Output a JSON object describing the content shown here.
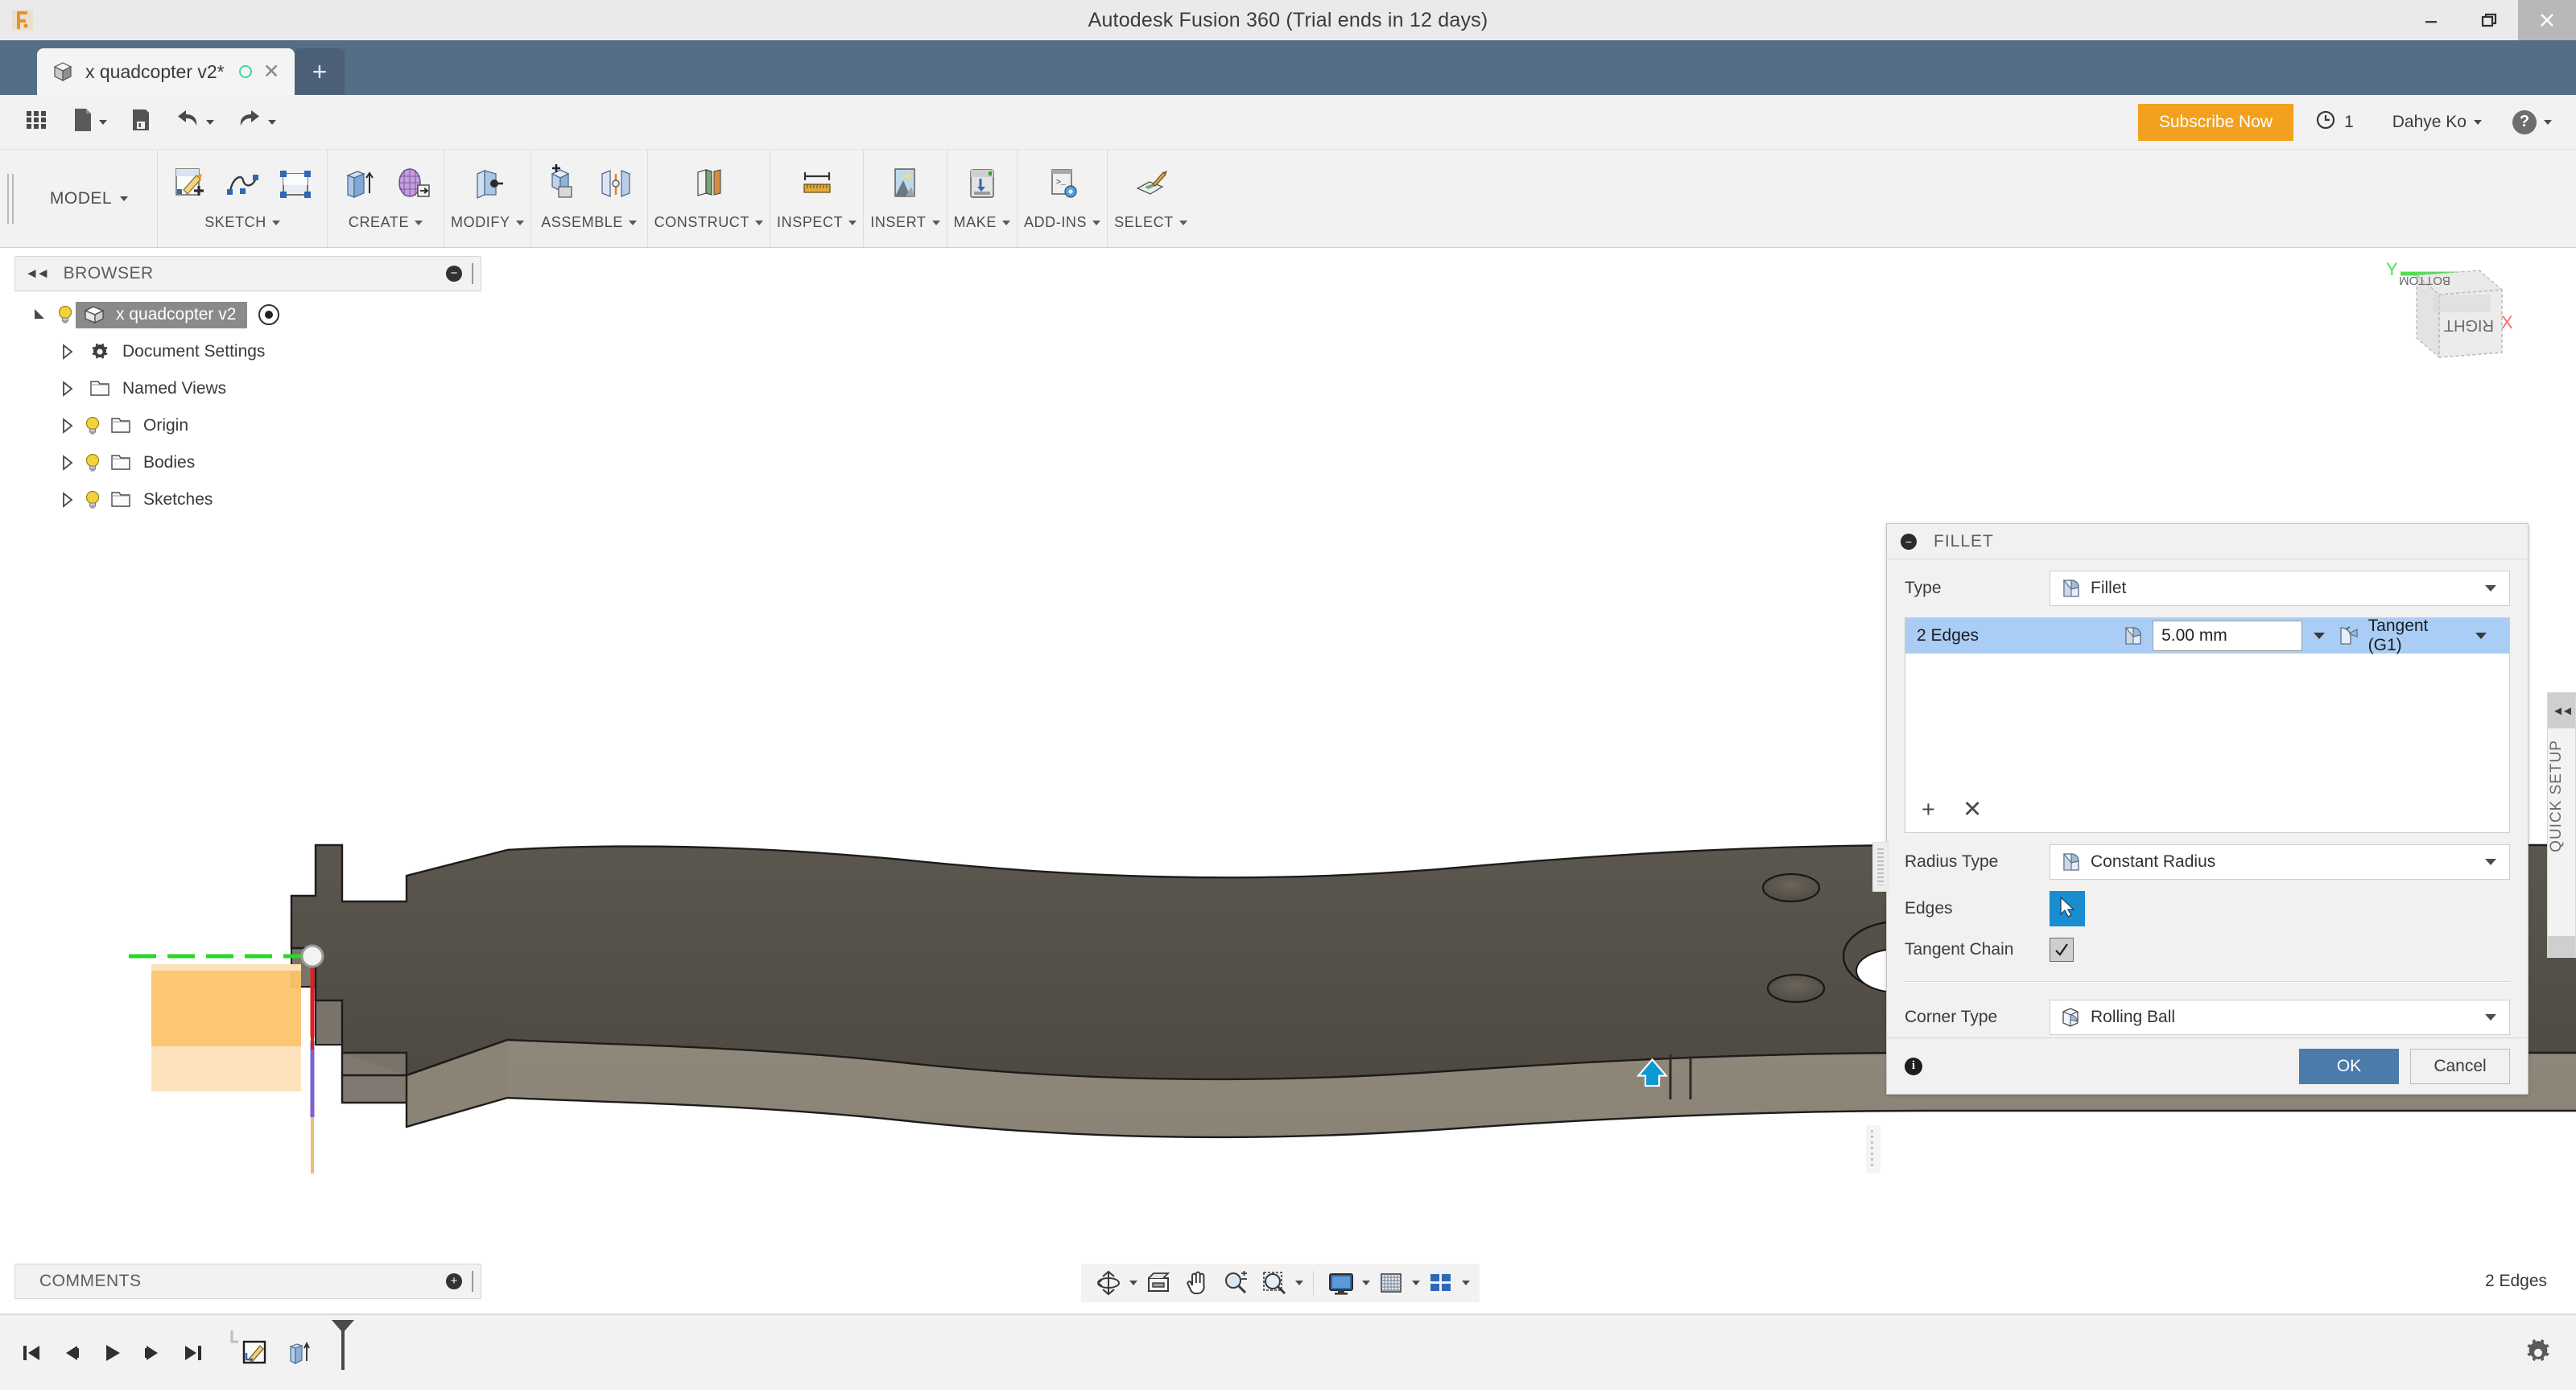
{
  "window": {
    "title": "Autodesk Fusion 360 (Trial ends in 12 days)",
    "app_icon": "fusion-logo-icon",
    "minimize": "–",
    "restore": "❐",
    "close": "✕"
  },
  "tabs": {
    "document": {
      "label": "x quadcopter v2*",
      "icon": "cube-icon",
      "save_state_icon": "unsaved-circle-icon",
      "close": "✕"
    },
    "new_tab": "+"
  },
  "quick_access": {
    "items": [
      {
        "name": "show-data-panel",
        "icon": "grid-icon",
        "caret": false
      },
      {
        "name": "file-menu",
        "icon": "file-icon",
        "caret": true
      },
      {
        "name": "save",
        "icon": "save-icon",
        "caret": false
      },
      {
        "name": "undo",
        "icon": "undo-icon",
        "caret": true
      },
      {
        "name": "redo",
        "icon": "redo-icon",
        "caret": true
      }
    ],
    "subscribe_label": "Subscribe Now",
    "subscribe_color": "#f2a01e",
    "job_count": "1",
    "job_icon": "clock-icon",
    "user_name": "Dahye Ko",
    "help_icon": "question-mark-icon"
  },
  "ribbon": {
    "workspace": "MODEL",
    "groups": [
      {
        "label": "SKETCH",
        "icons": [
          "create-sketch-icon",
          "spline-icon",
          "rectangle-icon"
        ]
      },
      {
        "label": "CREATE",
        "icons": [
          "extrude-icon",
          "form-icon"
        ]
      },
      {
        "label": "MODIFY",
        "icons": [
          "press-pull-icon"
        ]
      },
      {
        "label": "ASSEMBLE",
        "icons": [
          "new-component-icon",
          "joint-icon"
        ]
      },
      {
        "label": "CONSTRUCT",
        "icons": [
          "offset-plane-icon"
        ]
      },
      {
        "label": "INSPECT",
        "icons": [
          "measure-icon"
        ]
      },
      {
        "label": "INSERT",
        "icons": [
          "insert-image-icon"
        ]
      },
      {
        "label": "MAKE",
        "icons": [
          "3d-print-icon"
        ]
      },
      {
        "label": "ADD-INS",
        "icons": [
          "scripts-addins-icon"
        ]
      },
      {
        "label": "SELECT",
        "icons": [
          "select-paint-icon"
        ]
      }
    ]
  },
  "browser": {
    "title": "BROWSER",
    "collapse_icon": "double-chevron-left-icon",
    "minus_icon": "minus-circle-icon",
    "tree": [
      {
        "label": "x quadcopter v2",
        "icon": "component-cube-icon",
        "bulb": true,
        "indent": 0,
        "selected": true,
        "expanded": true,
        "radio": true
      },
      {
        "label": "Document Settings",
        "icon": "gear-icon",
        "bulb": false,
        "indent": 1,
        "selected": false,
        "expanded": false,
        "radio": false
      },
      {
        "label": "Named Views",
        "icon": "folder-icon",
        "bulb": false,
        "indent": 1,
        "selected": false,
        "expanded": false,
        "radio": false
      },
      {
        "label": "Origin",
        "icon": "folder-icon",
        "bulb": true,
        "indent": 1,
        "selected": false,
        "expanded": false,
        "radio": false
      },
      {
        "label": "Bodies",
        "icon": "folder-icon",
        "bulb": true,
        "indent": 1,
        "selected": false,
        "expanded": false,
        "radio": false
      },
      {
        "label": "Sketches",
        "icon": "folder-icon",
        "bulb": true,
        "indent": 1,
        "selected": false,
        "expanded": false,
        "radio": false
      }
    ]
  },
  "viewcube": {
    "face_front": "RIGHT",
    "face_top": "BOTTOM",
    "axis_y": "Y",
    "axis_x": "X",
    "axis_y_color": "#4fe04f",
    "axis_x_color": "#ff6a6a"
  },
  "quick_setup": {
    "label": "QUICK SETUP",
    "collapse_icon": "double-chevron-left-icon"
  },
  "fillet_dialog": {
    "title": "FILLET",
    "minimize_icon": "minus-circle-icon",
    "type_label": "Type",
    "type_value": "Fillet",
    "type_icon": "fillet-icon",
    "selection": {
      "count_label": "2 Edges",
      "edge_icon": "fillet-edge-icon",
      "radius_value": "5.00 mm",
      "continuity_icon": "tangent-icon",
      "continuity_value": "Tangent (G1)"
    },
    "add_icon": "+",
    "remove_icon": "✕",
    "radius_type_label": "Radius Type",
    "radius_type_value": "Constant Radius",
    "radius_type_icon": "constant-radius-icon",
    "edges_label": "Edges",
    "edges_button_icon": "select-cursor-icon",
    "edges_button_color": "#1a8cd0",
    "tangent_chain_label": "Tangent Chain",
    "tangent_chain_checked": true,
    "corner_type_label": "Corner Type",
    "corner_type_value": "Rolling Ball",
    "corner_type_icon": "rolling-ball-icon",
    "info_icon": "info-icon",
    "ok_label": "OK",
    "cancel_label": "Cancel",
    "ok_color": "#4a7bab",
    "highlight_color": "#aacdf5"
  },
  "comments": {
    "title": "COMMENTS",
    "add_icon": "plus-circle-icon"
  },
  "navbar": {
    "items": [
      {
        "name": "orbit",
        "icon": "orbit-icon",
        "caret": true
      },
      {
        "name": "look-at",
        "icon": "look-at-icon",
        "caret": false
      },
      {
        "name": "pan",
        "icon": "pan-hand-icon",
        "caret": false
      },
      {
        "name": "zoom",
        "icon": "zoom-icon",
        "caret": false
      },
      {
        "name": "zoom-window",
        "icon": "zoom-window-icon",
        "caret": true
      },
      {
        "name": "display-settings",
        "icon": "display-icon",
        "caret": true
      },
      {
        "name": "grid-snaps",
        "icon": "grid-snap-icon",
        "caret": true
      },
      {
        "name": "viewports",
        "icon": "viewports-icon",
        "caret": true
      }
    ]
  },
  "status_bar": {
    "selection_text": "2 Edges"
  },
  "timeline": {
    "controls": [
      {
        "name": "go-to-beginning",
        "icon": "skip-start-icon"
      },
      {
        "name": "step-back",
        "icon": "step-back-icon"
      },
      {
        "name": "play",
        "icon": "play-icon"
      },
      {
        "name": "step-forward",
        "icon": "step-forward-icon"
      },
      {
        "name": "go-to-end",
        "icon": "skip-end-icon"
      }
    ],
    "features": [
      {
        "name": "sketch-feature",
        "icon": "sketch-feature-icon"
      },
      {
        "name": "extrude-feature",
        "icon": "extrude-feature-icon"
      }
    ],
    "marker_icon": "timeline-marker-icon",
    "settings_icon": "gear-icon"
  },
  "model": {
    "cursor_icon": "blue-arrow-cursor",
    "body_top_color": "#58544c",
    "body_side_color": "#8d8679",
    "sketch_fill_color": "#fbc46a",
    "sketch_fill_light": "#fde2b8",
    "axis_x_color": "#33dd33",
    "axis_y_color": "#ee2222",
    "axis_z_color": "#f7b559",
    "origin_point": "origin-point-icon"
  }
}
